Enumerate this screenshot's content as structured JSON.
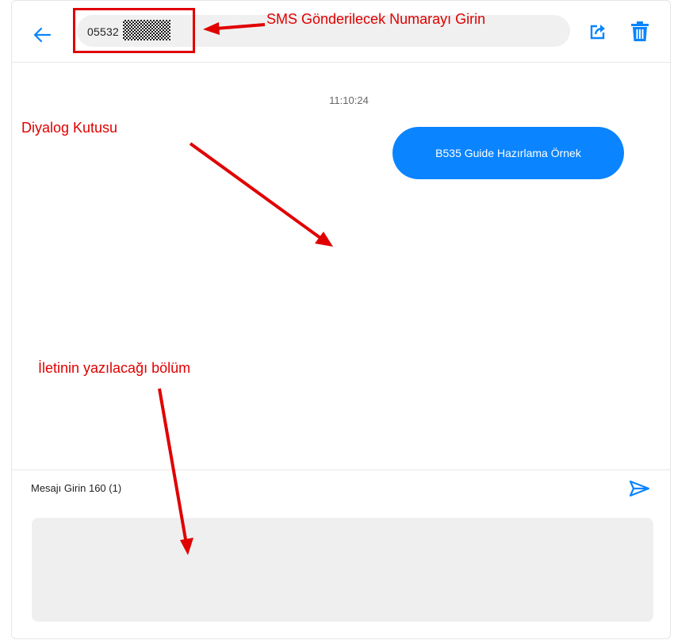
{
  "header": {
    "phone_value": "05532",
    "back_icon": "arrow-left-icon",
    "share_icon": "share-icon",
    "trash_icon": "trash-icon"
  },
  "conversation": {
    "timestamp": "11:10:24",
    "messages": [
      {
        "text": "B535 Guide Hazırlama Örnek",
        "direction": "sent"
      }
    ]
  },
  "composer": {
    "counter_label": "Mesajı Girin 160 (1)",
    "send_icon": "send-icon",
    "message_value": ""
  },
  "annotations": {
    "number_hint": "SMS Gönderilecek Numarayı Girin",
    "dialog_hint": "Diyalog Kutusu",
    "compose_hint": "İletinin yazılacağı bölüm"
  },
  "colors": {
    "accent": "#0a84ff",
    "annotation": "#e00000",
    "field_bg": "#efefef"
  }
}
